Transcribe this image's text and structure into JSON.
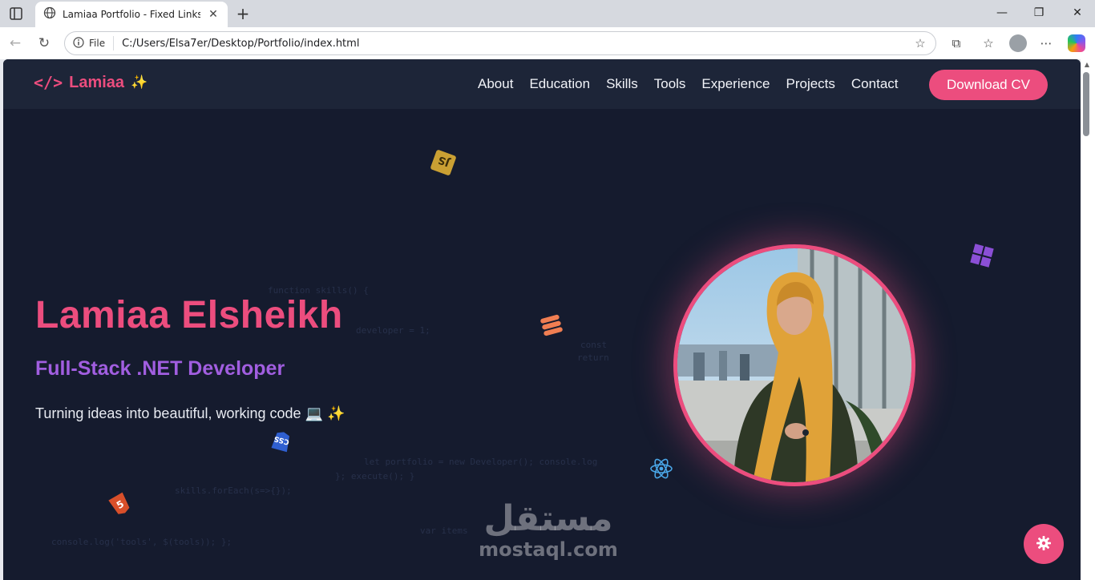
{
  "browser": {
    "tab_title": "Lamiaa Portfolio - Fixed Links",
    "address_label": "File",
    "url": "C:/Users/Elsa7er/Desktop/Portfolio/index.html"
  },
  "site": {
    "brand_code": "</>",
    "brand_name": "Lamiaa",
    "brand_emoji": "✨",
    "nav": [
      "About",
      "Education",
      "Skills",
      "Tools",
      "Experience",
      "Projects",
      "Contact"
    ],
    "cta": "Download CV"
  },
  "hero": {
    "name": "Lamiaa Elsheikh",
    "role": "Full-Stack .NET Developer",
    "tagline": "Turning ideas into beautiful, working code 💻 ✨"
  },
  "watermark": {
    "arabic": "مستقل",
    "latin": "mostaql.com"
  },
  "floating_icons": [
    "js-icon",
    "windows-icon",
    "stack-icon",
    "react-icon",
    "css-icon",
    "html5-icon"
  ],
  "colors": {
    "accent": "#ec4d7e",
    "role_purple": "#a15ee0",
    "background": "#151b2e",
    "nav_background": "#1d2538"
  }
}
